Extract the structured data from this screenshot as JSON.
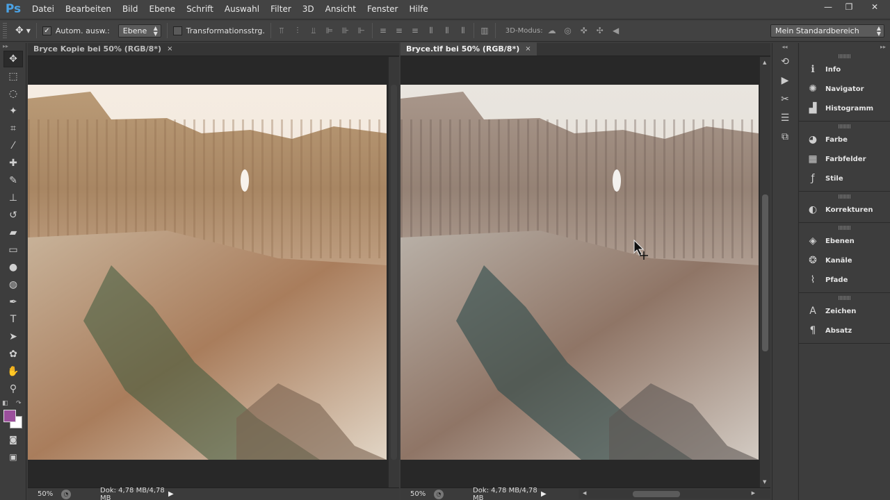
{
  "app": {
    "logo": "Ps",
    "menu": [
      "Datei",
      "Bearbeiten",
      "Bild",
      "Ebene",
      "Schrift",
      "Auswahl",
      "Filter",
      "3D",
      "Ansicht",
      "Fenster",
      "Hilfe"
    ],
    "window_controls": {
      "minimize": "—",
      "restore": "❐",
      "close": "✕"
    }
  },
  "options": {
    "auto_select_label": "Autom. ausw.:",
    "auto_select_checked": true,
    "auto_select_target": "Ebene",
    "transform_label": "Transformationsstrg.",
    "transform_checked": false,
    "mode3d_label": "3D-Modus:",
    "workspace": "Mein Standardbereich"
  },
  "tools": [
    {
      "name": "move-tool",
      "glyph": "✥",
      "active": true
    },
    {
      "name": "marquee-tool",
      "glyph": "⬚"
    },
    {
      "name": "lasso-tool",
      "glyph": "◌"
    },
    {
      "name": "magic-wand-tool",
      "glyph": "✦"
    },
    {
      "name": "crop-tool",
      "glyph": "⌗"
    },
    {
      "name": "eyedropper-tool",
      "glyph": "⁄"
    },
    {
      "name": "healing-brush-tool",
      "glyph": "✚"
    },
    {
      "name": "brush-tool",
      "glyph": "✎"
    },
    {
      "name": "clone-stamp-tool",
      "glyph": "⊥"
    },
    {
      "name": "history-brush-tool",
      "glyph": "↺"
    },
    {
      "name": "eraser-tool",
      "glyph": "▰"
    },
    {
      "name": "gradient-tool",
      "glyph": "▭"
    },
    {
      "name": "blur-tool",
      "glyph": "●"
    },
    {
      "name": "dodge-tool",
      "glyph": "◍"
    },
    {
      "name": "pen-tool",
      "glyph": "✒"
    },
    {
      "name": "type-tool",
      "glyph": "T"
    },
    {
      "name": "path-selection-tool",
      "glyph": "➤"
    },
    {
      "name": "shape-tool",
      "glyph": "✿"
    },
    {
      "name": "hand-tool",
      "glyph": "✋"
    },
    {
      "name": "zoom-tool",
      "glyph": "⚲"
    }
  ],
  "colors": {
    "foreground": "#9b4f9c",
    "background": "#ffffff"
  },
  "docs": [
    {
      "title": "Bryce Kopie bei 50% (RGB/8*)",
      "close": "×",
      "zoom": "50%",
      "doc_size": "Dok: 4,78 MB/4,78 MB",
      "active": false
    },
    {
      "title": "Bryce.tif bei 50% (RGB/8*)",
      "close": "×",
      "zoom": "50%",
      "doc_size": "Dok: 4,78 MB/4,78 MB",
      "active": true
    }
  ],
  "mini_dock": [
    {
      "name": "history-icon",
      "glyph": "⟲"
    },
    {
      "name": "actions-play-icon",
      "glyph": "▶"
    },
    {
      "name": "tool-presets-icon",
      "glyph": "✂"
    },
    {
      "name": "properties-icon",
      "glyph": "☰"
    },
    {
      "name": "layer-comps-icon",
      "glyph": "⧉"
    }
  ],
  "panels": [
    [
      {
        "name": "info",
        "label": "Info",
        "glyph": "ℹ"
      },
      {
        "name": "navigator",
        "label": "Navigator",
        "glyph": "✺"
      },
      {
        "name": "histogram",
        "label": "Histogramm",
        "glyph": "▟"
      }
    ],
    [
      {
        "name": "color",
        "label": "Farbe",
        "glyph": "◕"
      },
      {
        "name": "swatches",
        "label": "Farbfelder",
        "glyph": "▦"
      },
      {
        "name": "styles",
        "label": "Stile",
        "glyph": "ƒ"
      }
    ],
    [
      {
        "name": "adjustments",
        "label": "Korrekturen",
        "glyph": "◐"
      }
    ],
    [
      {
        "name": "layers",
        "label": "Ebenen",
        "glyph": "◈"
      },
      {
        "name": "channels",
        "label": "Kanäle",
        "glyph": "❂"
      },
      {
        "name": "paths",
        "label": "Pfade",
        "glyph": "⌇"
      }
    ],
    [
      {
        "name": "character",
        "label": "Zeichen",
        "glyph": "A"
      },
      {
        "name": "paragraph",
        "label": "Absatz",
        "glyph": "¶"
      }
    ]
  ]
}
